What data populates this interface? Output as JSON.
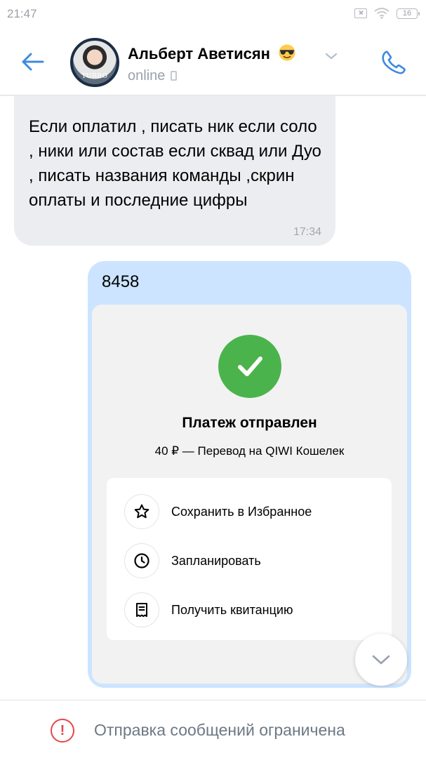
{
  "status_bar": {
    "time": "21:47",
    "battery": "16"
  },
  "header": {
    "contact_name": "Альберт Аветисян",
    "contact_status": "online",
    "avatar_caption": "TURBO"
  },
  "messages": {
    "incoming": {
      "text": "Если оплатил , писать ник если соло , ники или состав если сквад или Дуо , писать названия команды ,скрин оплаты и последние цифры",
      "time": "17:34"
    },
    "outgoing": {
      "text": "8458",
      "receipt": {
        "title": "Платеж отправлен",
        "subtitle": "40 ₽ — Перевод на QIWI Кошелек",
        "actions": [
          {
            "label": "Сохранить в Избранное",
            "icon": "star-icon"
          },
          {
            "label": "Запланировать",
            "icon": "clock-icon"
          },
          {
            "label": "Получить квитанцию",
            "icon": "receipt-icon"
          }
        ]
      }
    }
  },
  "bottom_bar": {
    "text": "Отправка сообщений ограничена"
  },
  "colors": {
    "accent": "#3f8ae0",
    "outgoing_bubble": "#cce4ff",
    "incoming_bubble": "#ebedf0",
    "success": "#4bb34b",
    "warning": "#e64646"
  }
}
